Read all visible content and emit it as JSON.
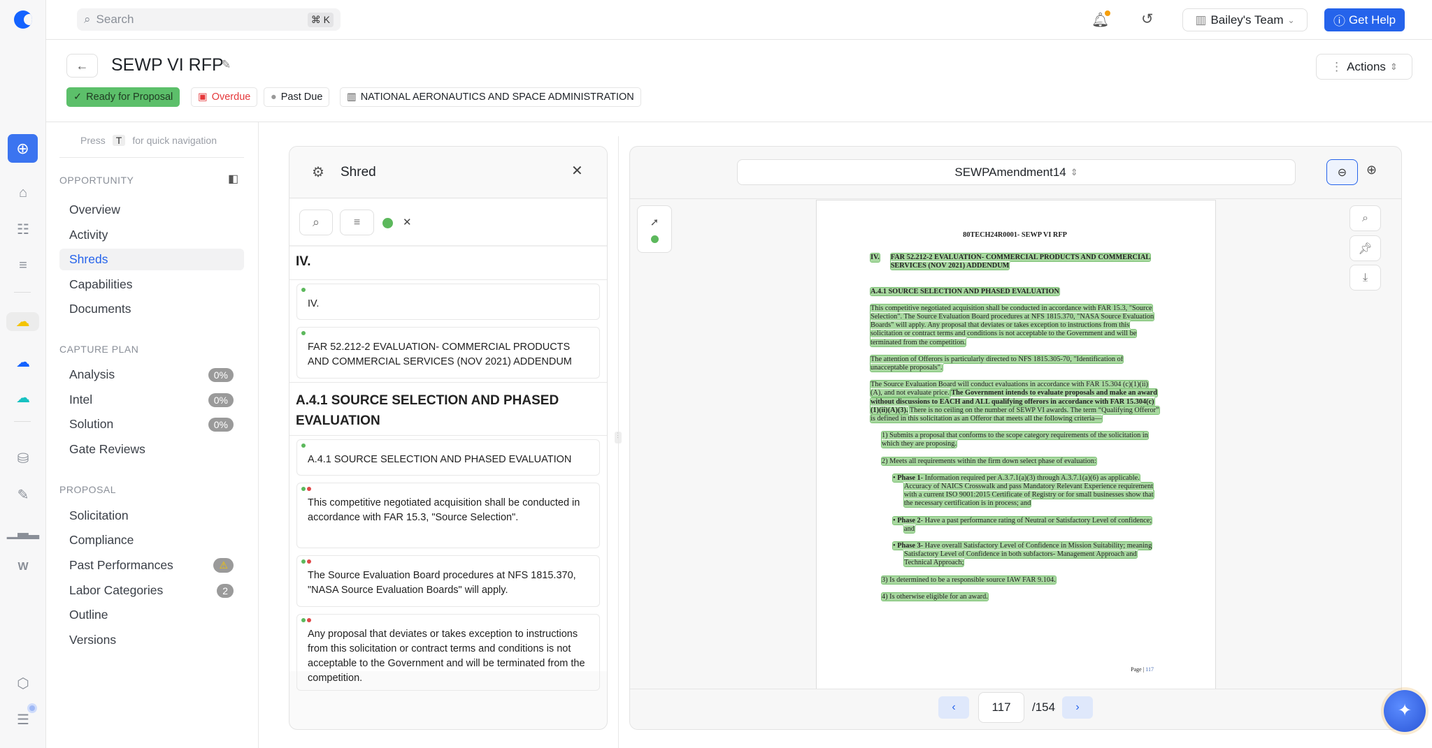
{
  "app": {
    "search_placeholder": "Search",
    "search_shortcut": "⌘ K",
    "team": "Bailey's Team",
    "help": "Get Help",
    "accent": "#2563eb"
  },
  "header": {
    "title": "SEWP VI RFP",
    "actions": "Actions",
    "tags": [
      {
        "label": "Ready for Proposal",
        "color": "#5cbf6a"
      },
      {
        "label": "Overdue",
        "color": "#e5383b"
      },
      {
        "label": "Past Due"
      },
      {
        "label": "NATIONAL AERONAUTICS AND SPACE ADMINISTRATION"
      }
    ]
  },
  "nav": {
    "hint_press": "Press",
    "hint_key": "T",
    "hint_rest": "for quick navigation",
    "sections": [
      {
        "title": "OPPORTUNITY",
        "items": [
          {
            "label": "Overview"
          },
          {
            "label": "Activity"
          },
          {
            "label": "Shreds",
            "active": true
          },
          {
            "label": "Capabilities"
          },
          {
            "label": "Documents"
          }
        ]
      },
      {
        "title": "CAPTURE PLAN",
        "items": [
          {
            "label": "Analysis",
            "badge": "0%"
          },
          {
            "label": "Intel",
            "badge": "0%"
          },
          {
            "label": "Solution",
            "badge": "0%"
          },
          {
            "label": "Gate Reviews"
          }
        ]
      },
      {
        "title": "PROPOSAL",
        "items": [
          {
            "label": "Solicitation"
          },
          {
            "label": "Compliance"
          },
          {
            "label": "Past Performances",
            "badge": "⚠"
          },
          {
            "label": "Labor Categories",
            "badge": "2"
          },
          {
            "label": "Outline"
          },
          {
            "label": "Versions"
          }
        ]
      }
    ]
  },
  "shred": {
    "title": "Shred",
    "headings": [
      "IV.",
      "A.4.1 SOURCE SELECTION AND PHASED EVALUATION"
    ],
    "cards": [
      {
        "text": "IV.",
        "dots": [
          "green"
        ]
      },
      {
        "text": "FAR 52.212-2 EVALUATION- COMMERCIAL PRODUCTS AND COMMERCIAL SERVICES (NOV 2021) ADDENDUM",
        "dots": [
          "green"
        ]
      },
      {
        "text": "A.4.1 SOURCE SELECTION AND PHASED EVALUATION",
        "dots": [
          "green"
        ]
      },
      {
        "text": "This competitive negotiated acquisition shall be conducted in accordance with FAR 15.3, \"Source Selection\".",
        "dots": [
          "green",
          "red"
        ]
      },
      {
        "text": "The Source Evaluation Board procedures at NFS 1815.370, \"NASA Source Evaluation Boards\" will apply.",
        "dots": [
          "green",
          "red"
        ]
      },
      {
        "text": "Any proposal that deviates or takes exception to instructions from this solicitation or contract terms and conditions is not acceptable to the Government and will be terminated from the competition.",
        "dots": [
          "green",
          "red"
        ]
      }
    ]
  },
  "viewer": {
    "document": "SEWPAmendment14",
    "page": "117",
    "total": "/154",
    "page_content": {
      "header": "80TECH24R0001- SEWP VI RFP",
      "sec_num": "IV.",
      "sec_title": "FAR 52.212-2 EVALUATION- COMMERCIAL PRODUCTS AND COMMERCIAL SERVICES (NOV 2021) ADDENDUM",
      "sub": "A.4.1 SOURCE SELECTION AND PHASED EVALUATION",
      "p1": "This competitive negotiated acquisition shall be conducted in accordance with FAR 15.3, \"Source Selection\". The Source Evaluation Board procedures at NFS 1815.370, \"NASA Source Evaluation Boards\" will apply. Any proposal that deviates or takes exception to instructions from this solicitation or contract terms and conditions is not acceptable to the Government and will be terminated from the competition.",
      "p2": "The attention of Offerors is particularly directed to NFS 1815.305-70, \"Identification of unacceptable proposals\".",
      "p3a": "The Source Evaluation Board will conduct evaluations in accordance with FAR 15.304 (c)(1)(ii)(A), and not evaluate price.",
      "p3b": "The Government intends to evaluate proposals and make an award without discussions to EACH and ALL qualifying offerors in accordance with FAR 15.304(c)(1)(ii)(A)(3).",
      "p3c": "There is no ceiling on the number of SEWP VI awards. The term “Qualifying Offeror” is defined in this solicitation as an Offeror that meets all the following criteria—",
      "c1": "1)  Submits a proposal that conforms to the scope category requirements of the solicitation in which they are proposing.",
      "c2": "2)  Meets all requirements within the firm down select phase of evaluation:",
      "ph1b": "Phase 1",
      "ph1": "- Information required per A.3.7.1(a)(3) through A.3.7.1(a)(6) as applicable. Accuracy of NAICS Crosswalk and pass Mandatory Relevant Experience requirement with a current ISO 9001:2015 Certificate of Registry or for small businesses show that the necessary certification is in process; and",
      "ph2b": "Phase 2",
      "ph2": "- Have a past performance rating of Neutral or Satisfactory Level of confidence; and",
      "ph3b": "Phase 3-",
      "ph3": " Have overall Satisfactory Level of Confidence in Mission Suitability; meaning Satisfactory Level of Confidence in both subfactors- Management Approach and Technical Approach;",
      "c3": "3)  Is determined to be a responsible source IAW FAR 9.104.",
      "c4": "4)  Is otherwise eligible for an award.",
      "footer_label": "Page |",
      "footer_num": "117"
    }
  }
}
